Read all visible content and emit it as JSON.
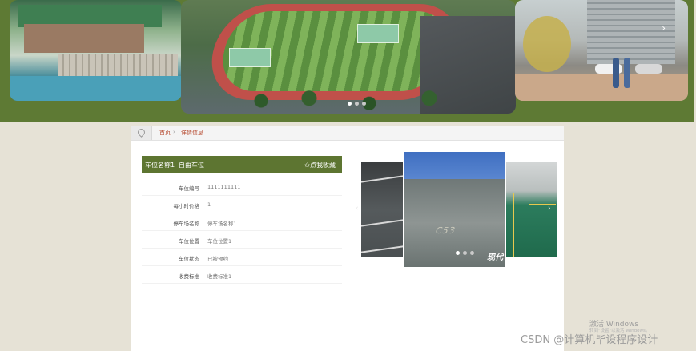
{
  "banner": {
    "next_arrow": "›",
    "dots": [
      true,
      false,
      false
    ]
  },
  "breadcrumb": {
    "home": "首页",
    "separator": "›",
    "current": "详情信息"
  },
  "detail": {
    "title_label": "车位名称1",
    "title_value": "自由车位",
    "favorite": "✩点我收藏",
    "rows": [
      {
        "key": "车位编号",
        "value": "1111111111"
      },
      {
        "key": "每小时价格",
        "value": "1"
      },
      {
        "key": "停车场名称",
        "value": "停车场名称1"
      },
      {
        "key": "车位位置",
        "value": "车位位置1"
      },
      {
        "key": "车位状态",
        "value": "已被预约"
      },
      {
        "key": "收费标准",
        "value": "收费标准1"
      }
    ]
  },
  "carousel": {
    "prev": "‹",
    "next": "›",
    "stall_marking": "C53",
    "photo_watermark": "现代",
    "dots": [
      true,
      false,
      false
    ]
  },
  "overlay": {
    "activate_windows": "激活 Windows",
    "activate_hint": "转到\"设置\"以激活 Windows。",
    "csdn": "CSDN @计算机毕设程序设计"
  },
  "colors": {
    "banner_bg": "#5e7a34",
    "header_bar": "#5d7531",
    "breadcrumb_link": "#b5462b",
    "page_bg": "#e6e2d6"
  }
}
